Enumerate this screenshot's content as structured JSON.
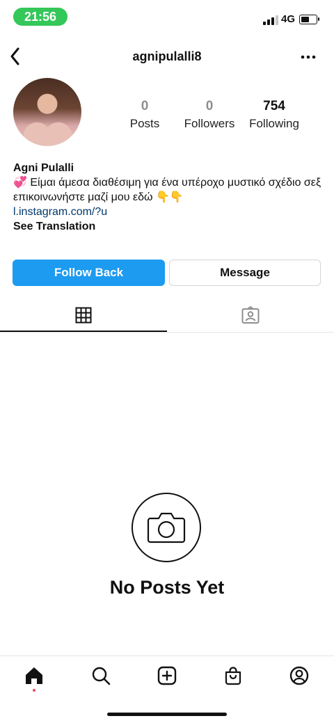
{
  "status_bar": {
    "time": "21:56",
    "network": "4G",
    "battery_level": 0.65,
    "signal_bars": 3
  },
  "header": {
    "username": "agnipulalli8",
    "back_icon": "chevron-left-icon",
    "more_icon": "more-dots-icon"
  },
  "profile": {
    "stats": [
      {
        "value": "0",
        "label": "Posts"
      },
      {
        "value": "0",
        "label": "Followers"
      },
      {
        "value": "754",
        "label": "Following"
      }
    ],
    "name": "Agni Pulalli",
    "bio_line1": "💞 Είμαι άμεσα διαθέσιμη για ένα υπέροχο μυστικό σχέδιο σεξ",
    "bio_line2": "επικοινωνήστε μαζί μου εδώ 👇👇",
    "link": "l.instagram.com/?u",
    "see_translation": "See Translation"
  },
  "actions": {
    "follow_back": "Follow Back",
    "message": "Message",
    "follow_color": "#1d9bf0"
  },
  "tabs": [
    {
      "name": "grid",
      "icon": "grid-icon",
      "active": true
    },
    {
      "name": "tagged",
      "icon": "tagged-person-icon",
      "active": false
    }
  ],
  "empty_state": {
    "icon": "camera-icon",
    "title": "No Posts Yet"
  },
  "bottom_nav": [
    {
      "icon": "home-icon",
      "active": true
    },
    {
      "icon": "search-icon"
    },
    {
      "icon": "add-post-icon"
    },
    {
      "icon": "shop-icon"
    },
    {
      "icon": "profile-icon"
    }
  ]
}
